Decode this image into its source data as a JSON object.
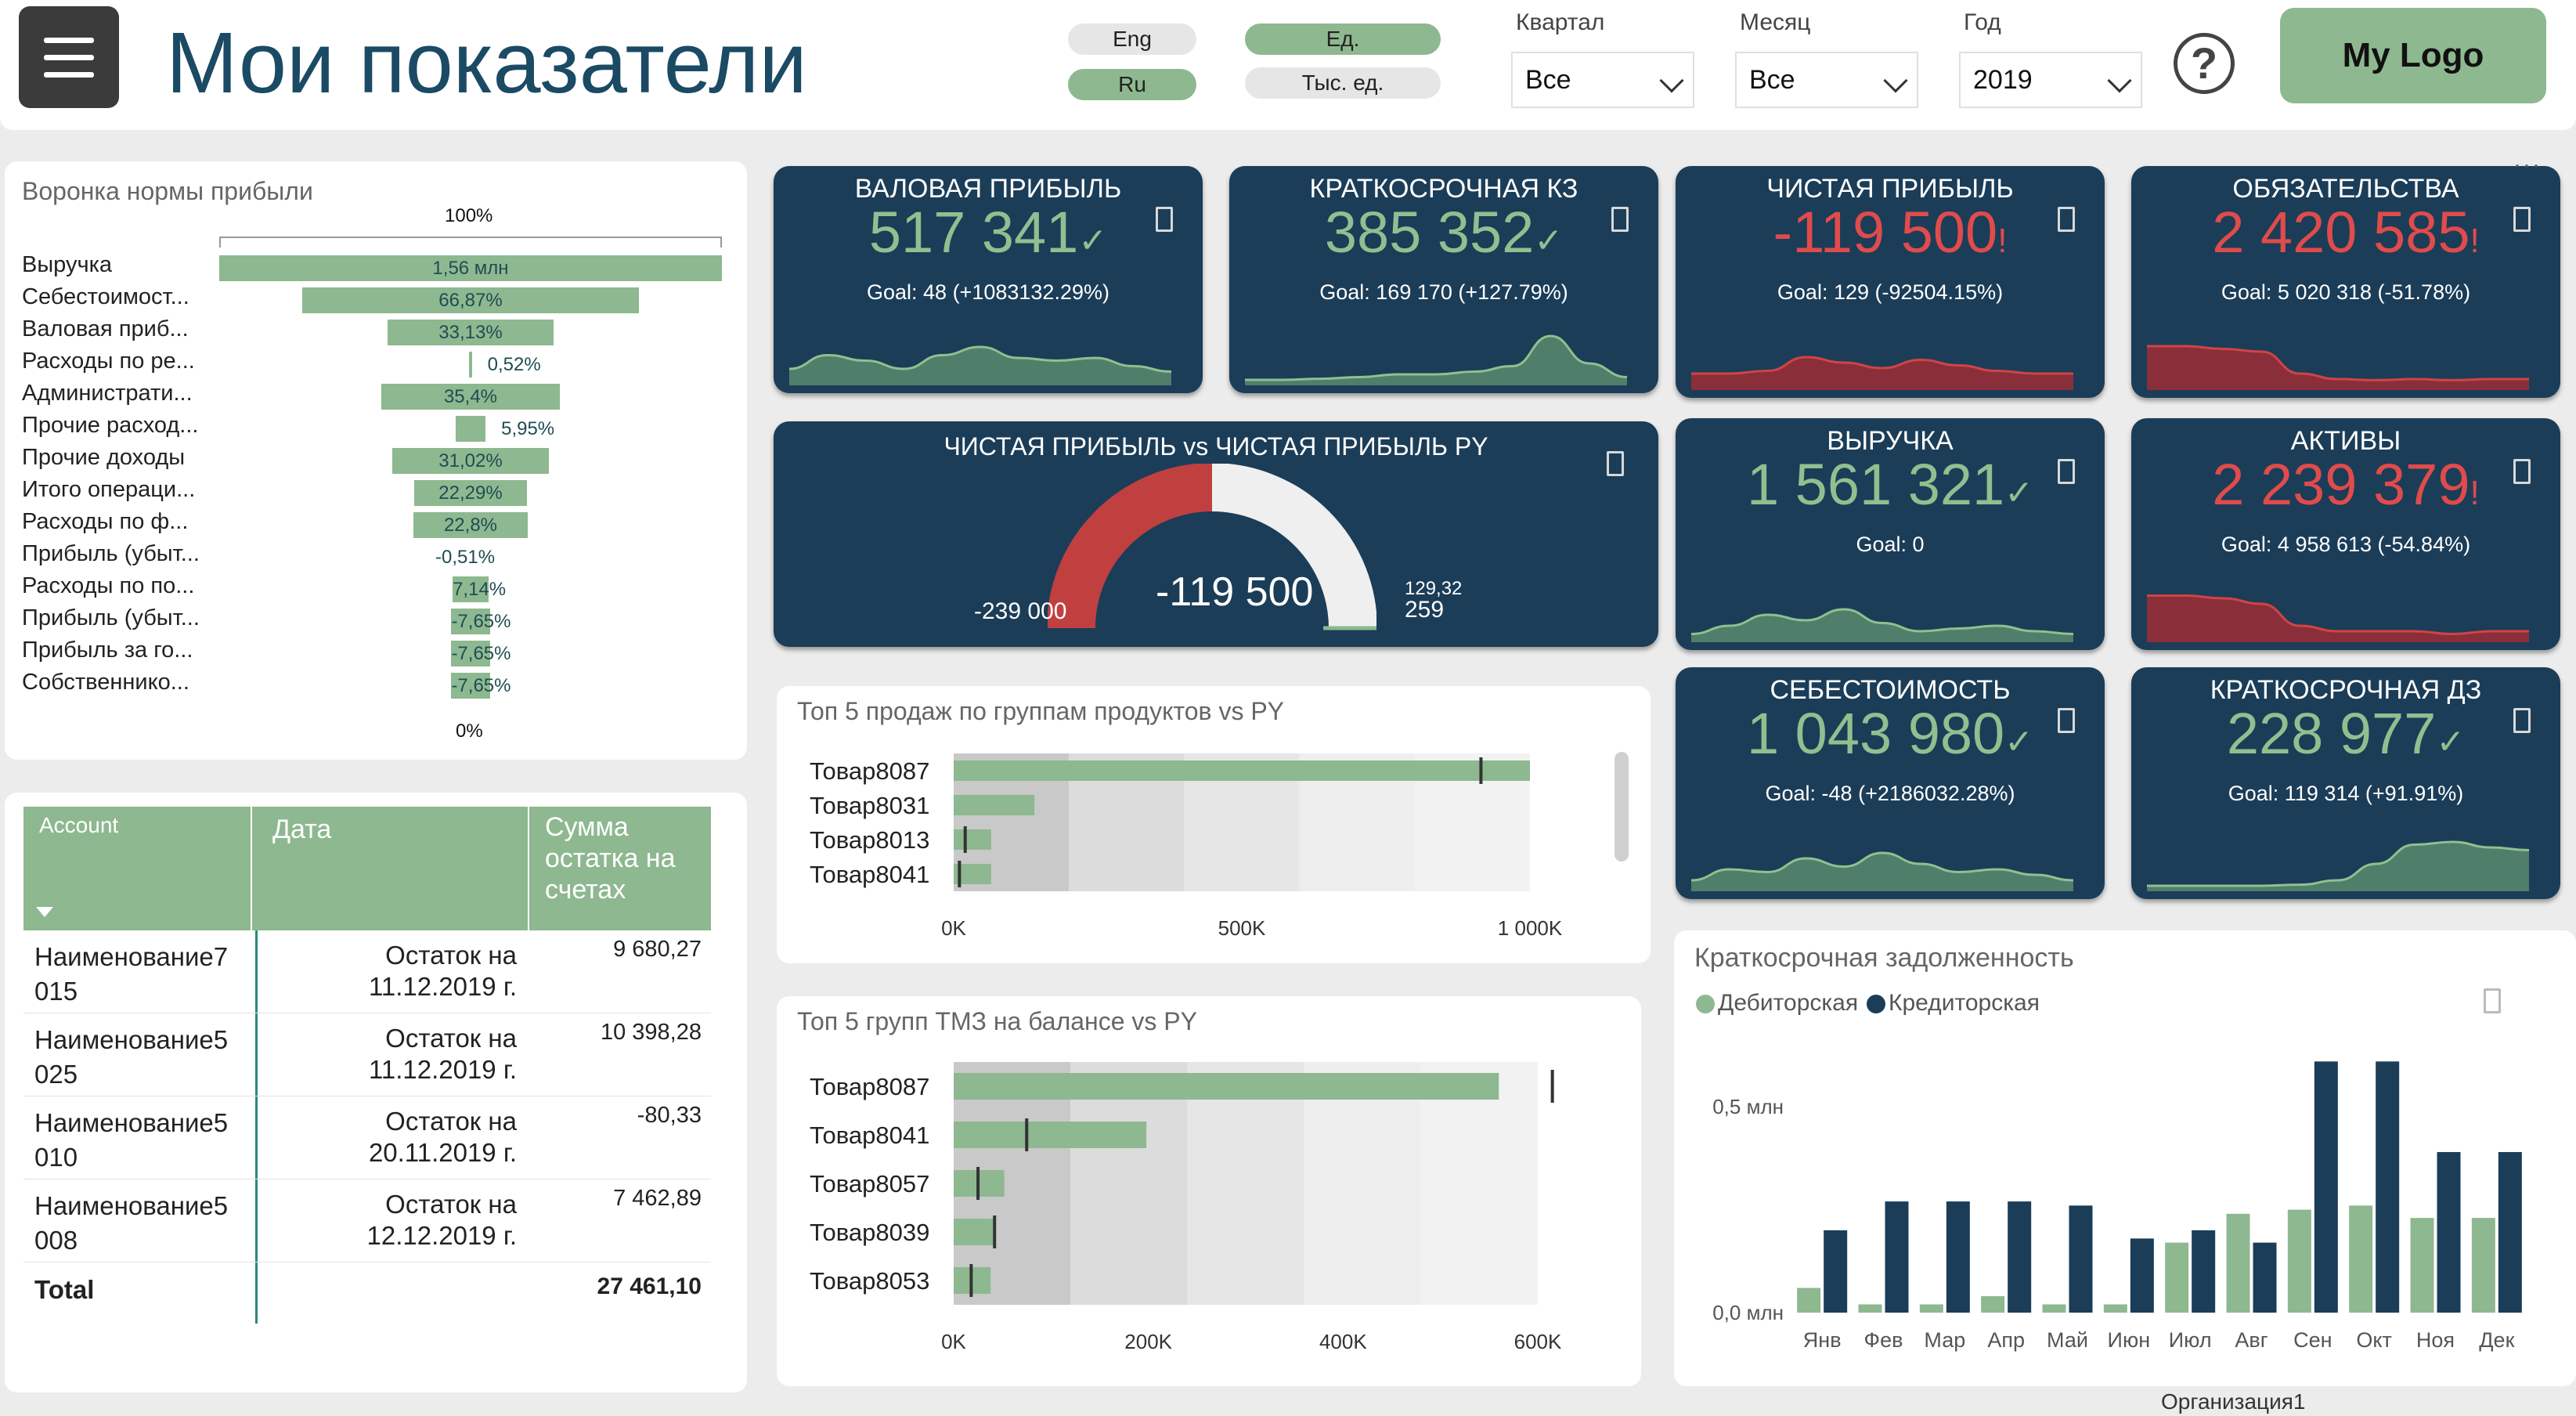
{
  "header": {
    "title": "Мои показатели",
    "lang_en": "Eng",
    "lang_ru": "Ru",
    "unit_1": "Ед.",
    "unit_1000": "Тыс. ед.",
    "filters": [
      {
        "label": "Квартал",
        "value": "Все"
      },
      {
        "label": "Месяц",
        "value": "Все"
      },
      {
        "label": "Год",
        "value": "2019"
      }
    ],
    "help": "?",
    "logo": "My Logo"
  },
  "funnel": {
    "title": "Воронка нормы прибыли",
    "top_label": "100%",
    "bottom_label": "0%",
    "rows": [
      {
        "label": "Выручка",
        "value_text": "1,56 млн",
        "pct": 100
      },
      {
        "label": "Себестоимост...",
        "value_text": "66,87%",
        "pct": 66.87
      },
      {
        "label": "Валовая приб...",
        "value_text": "33,13%",
        "pct": 33.13
      },
      {
        "label": "Расходы по ре...",
        "value_text": "0,52%",
        "pct": 0.52
      },
      {
        "label": "Администрати...",
        "value_text": "35,4%",
        "pct": 35.4
      },
      {
        "label": "Прочие расход...",
        "value_text": "5,95%",
        "pct": 5.95
      },
      {
        "label": "Прочие доходы",
        "value_text": "31,02%",
        "pct": 31.02
      },
      {
        "label": "Итого операци...",
        "value_text": "22,29%",
        "pct": 22.29
      },
      {
        "label": "Расходы по ф...",
        "value_text": "22,8%",
        "pct": 22.8
      },
      {
        "label": "Прибыль (убыт...",
        "value_text": "-0,51%",
        "pct": -0.51
      },
      {
        "label": "Расходы по по...",
        "value_text": "7,14%",
        "pct": 7.14
      },
      {
        "label": "Прибыль (убыт...",
        "value_text": "-7,65%",
        "pct": -7.65
      },
      {
        "label": "Прибыль за го...",
        "value_text": "-7,65%",
        "pct": -7.65
      },
      {
        "label": "Собственнико...",
        "value_text": "-7,65%",
        "pct": -7.65
      }
    ]
  },
  "accounts": {
    "col_account": "Account",
    "col_date": "Дата",
    "col_sum": "Сумма остатка на счетах",
    "rows": [
      {
        "name": "Наименование7 015",
        "date": "Остаток на 11.12.2019 г.",
        "sum": "9 680,27"
      },
      {
        "name": "Наименование5 025",
        "date": "Остаток на 11.12.2019 г.",
        "sum": "10 398,28"
      },
      {
        "name": "Наименование5 010",
        "date": "Остаток на 20.11.2019 г.",
        "sum": "-80,33"
      },
      {
        "name": "Наименование5 008",
        "date": "Остаток на 12.12.2019 г.",
        "sum": "7 462,89"
      }
    ],
    "total_label": "Total",
    "total_value": "27 461,10"
  },
  "kpis": [
    {
      "title": "ВАЛОВАЯ ПРИБЫЛЬ",
      "value": "517 341",
      "status": "✓",
      "goal": "Goal: 48 (+1083132.29%)",
      "color": "#8fc08f"
    },
    {
      "title": "КРАТКОСРОЧНАЯ КЗ",
      "value": "385 352",
      "status": "✓",
      "goal": "Goal: 169 170 (+127.79%)",
      "color": "#8fc08f"
    },
    {
      "title": "ЧИСТАЯ ПРИБЫЛЬ",
      "value": "-119 500",
      "status": "!",
      "goal": "Goal: 129 (-92504.15%)",
      "color": "#e04b4b"
    },
    {
      "title": "ОБЯЗАТЕЛЬСТВА",
      "value": "2 420 585",
      "status": "!",
      "goal": "Goal: 5 020 318 (-51.78%)",
      "color": "#e04b4b"
    },
    {
      "title": "ВЫРУЧКА",
      "value": "1 561 321",
      "status": "✓",
      "goal": "Goal: 0",
      "color": "#8fc08f"
    },
    {
      "title": "АКТИВЫ",
      "value": "2 239 379",
      "status": "!",
      "goal": "Goal: 4 958 613 (-54.84%)",
      "color": "#e04b4b"
    },
    {
      "title": "СЕБЕСТОИМОСТЬ",
      "value": "1 043 980",
      "status": "✓",
      "goal": "Goal: -48 (+2186032.28%)",
      "color": "#8fc08f"
    },
    {
      "title": "КРАТКОСРОЧНАЯ ДЗ",
      "value": "228 977",
      "status": "✓",
      "goal": "Goal: 119 314 (+91.91%)",
      "color": "#8fc08f"
    }
  ],
  "gauge": {
    "title": "ЧИСТАЯ ПРИБЫЛЬ vs ЧИСТАЯ ПРИБЫЛЬ PY",
    "value": "-119 500",
    "min": "-239 000",
    "max": "259",
    "target": "129,32"
  },
  "chart_data": [
    {
      "type": "bar",
      "title": "Топ 5 продаж по группам продуктов vs PY",
      "categories": [
        "Товар8087",
        "Товар8031",
        "Товар8013",
        "Товар8041"
      ],
      "series": [
        {
          "values": [
            1000000,
            140000,
            65000,
            65000
          ]
        }
      ],
      "py_markers": [
        915000,
        0,
        20000,
        10000
      ],
      "ticks": [
        "0K",
        "500K",
        "1 000K"
      ],
      "xlim": [
        0,
        1000000
      ]
    },
    {
      "type": "bar",
      "title": "Топ 5 групп ТМЗ на балансе vs PY",
      "categories": [
        "Товар8087",
        "Товар8041",
        "Товар8057",
        "Товар8039",
        "Товар8053"
      ],
      "series": [
        {
          "values": [
            560000,
            198000,
            52000,
            42000,
            38000
          ]
        }
      ],
      "py_markers": [
        615000,
        75000,
        25000,
        42000,
        18000
      ],
      "ticks": [
        "0K",
        "200K",
        "400K",
        "600K"
      ],
      "xlim": [
        0,
        600000
      ]
    },
    {
      "type": "bar",
      "title": "Краткосрочная задолженность",
      "categories": [
        "Янв",
        "Фев",
        "Мар",
        "Апр",
        "Май",
        "Июн",
        "Июл",
        "Авг",
        "Сен",
        "Окт",
        "Ноя",
        "Дек"
      ],
      "series": [
        {
          "name": "Дебиторская",
          "color": "#8eb890",
          "values": [
            0.06,
            0.02,
            0.02,
            0.04,
            0.02,
            0.02,
            0.17,
            0.24,
            0.25,
            0.26,
            0.23,
            0.23
          ]
        },
        {
          "name": "Кредиторская",
          "color": "#1b3d58",
          "values": [
            0.2,
            0.27,
            0.27,
            0.27,
            0.26,
            0.18,
            0.2,
            0.17,
            0.61,
            0.61,
            0.39,
            0.39
          ]
        }
      ],
      "ticks": [
        "0,5 млн",
        "0,0 млн"
      ],
      "ylim": [
        0,
        0.7
      ]
    }
  ],
  "footer": {
    "org": "Организация1"
  }
}
